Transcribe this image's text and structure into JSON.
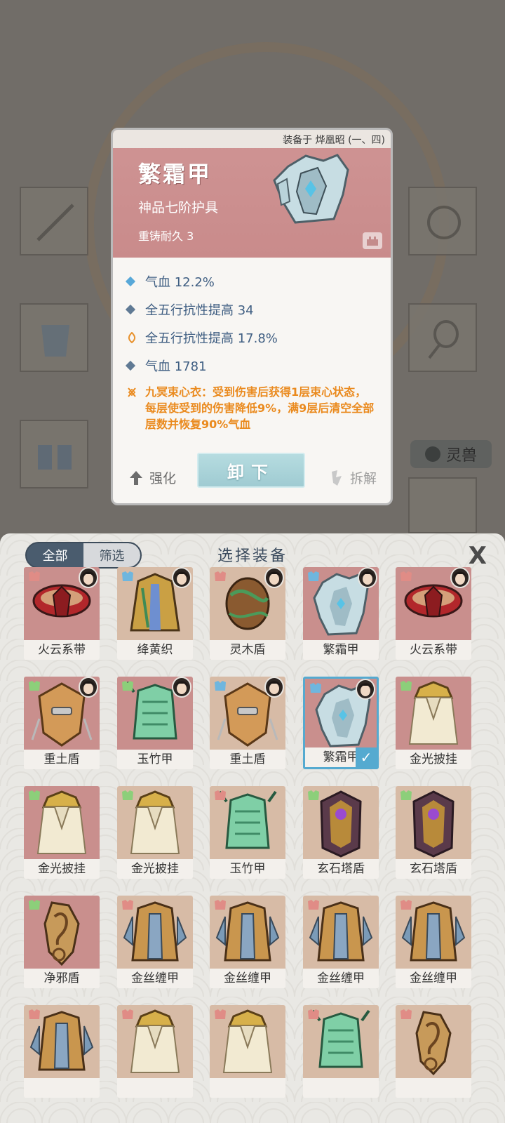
{
  "popup": {
    "equipped_on": "装备于 烨凰昭 (一、四)",
    "name": "繁霜甲",
    "grade": "神品七阶护具",
    "reforge": "重铸耐久 3",
    "stats": [
      {
        "text": "气血 12.2%",
        "color": "#58a8d8"
      },
      {
        "text": "全五行抗性提高 34",
        "color": "#607a94"
      },
      {
        "text": "全五行抗性提高 17.8%",
        "color": "#e8922e"
      },
      {
        "text": "气血 1781",
        "color": "#607a94"
      }
    ],
    "special": "九冥束心衣：受到伤害后获得1层束心状态，每层使受到的伤害降低9%，满9层后清空全部层数并恢复90%气血",
    "enhance_label": "强化",
    "unequip_label": "卸下",
    "dismantle_label": "拆解"
  },
  "background": {
    "pet_tab": "灵兽"
  },
  "panel": {
    "filter_all": "全部",
    "filter_screen": "筛选",
    "title": "选择装备",
    "close": "X",
    "items": [
      {
        "name": "火云系带",
        "bg": "#c98f8d",
        "art": "belt-red",
        "badge": "#e08c86",
        "equipped": true
      },
      {
        "name": "绛黄织",
        "bg": "#d7bba6",
        "art": "robe-gold",
        "badge": "#6fb6de",
        "equipped": true
      },
      {
        "name": "灵木盾",
        "bg": "#d7bba6",
        "art": "shield-wood",
        "badge": "#e08c86",
        "equipped": true
      },
      {
        "name": "繁霜甲",
        "bg": "#c98f8d",
        "art": "armor-ice",
        "badge": "#6fb6de",
        "equipped": true
      },
      {
        "name": "火云系带",
        "bg": "#c98f8d",
        "art": "belt-red",
        "badge": "#e08c86",
        "equipped": true
      },
      {
        "name": "重土盾",
        "bg": "#c98f8d",
        "art": "shield-earth",
        "badge": "#8ccf7a",
        "equipped": true
      },
      {
        "name": "玉竹甲",
        "bg": "#c98f8d",
        "art": "armor-jade",
        "badge": "#8ccf7a",
        "equipped": true
      },
      {
        "name": "重土盾",
        "bg": "#d7bba6",
        "art": "shield-earth",
        "badge": "#6fb6de",
        "equipped": true
      },
      {
        "name": "繁霜甲",
        "bg": "#c98f8d",
        "art": "armor-ice",
        "badge": "#6fb6de",
        "equipped": true,
        "selected": true,
        "check": "✓"
      },
      {
        "name": "金光披挂",
        "bg": "#c98f8d",
        "art": "cape-gold",
        "badge": "#8ccf7a",
        "equipped": false
      },
      {
        "name": "金光披挂",
        "bg": "#c98f8d",
        "art": "cape-gold",
        "badge": "#8ccf7a",
        "equipped": false
      },
      {
        "name": "金光披挂",
        "bg": "#d7bba6",
        "art": "cape-gold",
        "badge": "#8ccf7a",
        "equipped": false
      },
      {
        "name": "玉竹甲",
        "bg": "#d7bba6",
        "art": "armor-jade",
        "badge": "#e08c86",
        "equipped": false
      },
      {
        "name": "玄石塔盾",
        "bg": "#d7bba6",
        "art": "shield-tower",
        "badge": "#8ccf7a",
        "equipped": false
      },
      {
        "name": "玄石塔盾",
        "bg": "#d7bba6",
        "art": "shield-tower",
        "badge": "#8ccf7a",
        "equipped": false
      },
      {
        "name": "净邪盾",
        "bg": "#c98f8d",
        "art": "shield-dragon",
        "badge": "#8ccf7a",
        "equipped": false
      },
      {
        "name": "金丝缠甲",
        "bg": "#d7bba6",
        "art": "vest-gold",
        "badge": "#e08c86",
        "equipped": false
      },
      {
        "name": "金丝缠甲",
        "bg": "#d7bba6",
        "art": "vest-gold",
        "badge": "#e08c86",
        "equipped": false
      },
      {
        "name": "金丝缠甲",
        "bg": "#d7bba6",
        "art": "vest-gold",
        "badge": "#e08c86",
        "equipped": false
      },
      {
        "name": "金丝缠甲",
        "bg": "#d7bba6",
        "art": "vest-gold",
        "badge": "#e08c86",
        "equipped": false
      },
      {
        "name": "",
        "bg": "#d7bba6",
        "art": "vest-gold",
        "badge": "#e08c86",
        "equipped": false
      },
      {
        "name": "",
        "bg": "#d7bba6",
        "art": "cape-gold",
        "badge": "#e08c86",
        "equipped": false
      },
      {
        "name": "",
        "bg": "#d7bba6",
        "art": "cape-gold",
        "badge": "#e08c86",
        "equipped": false
      },
      {
        "name": "",
        "bg": "#d7bba6",
        "art": "armor-jade",
        "badge": "#e08c86",
        "equipped": false
      },
      {
        "name": "",
        "bg": "#d7bba6",
        "art": "shield-dragon",
        "badge": "#e08c86",
        "equipped": false
      }
    ]
  },
  "colors": {
    "accent_blue": "#55aad0",
    "special_orange": "#ea8a1e",
    "header_rose": "#cf9494"
  }
}
